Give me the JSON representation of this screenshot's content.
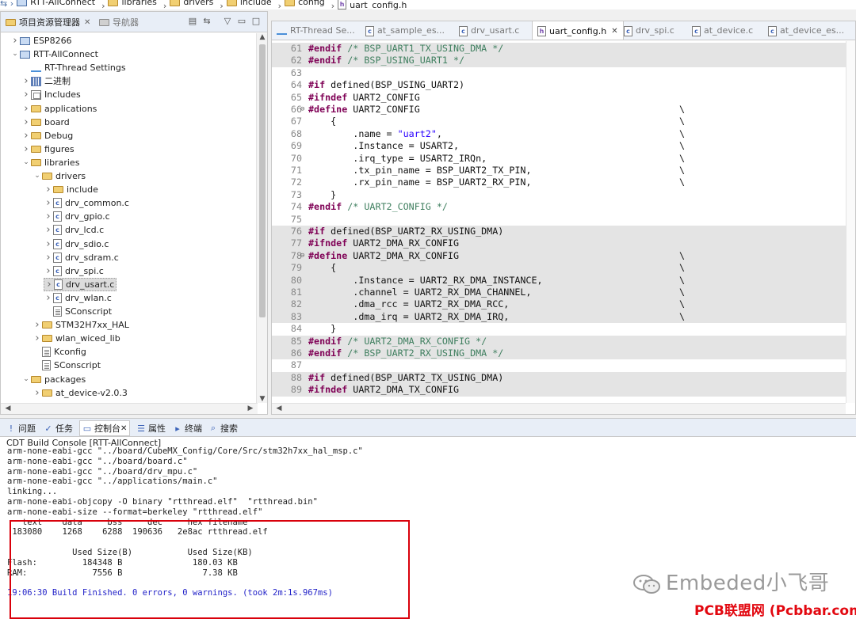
{
  "breadcrumb": [
    "RTT-AllConnect",
    "libraries",
    "drivers",
    "include",
    "config",
    "uart_config.h"
  ],
  "left_panel": {
    "tab_active": "项目资源管理器",
    "tab_other": "导航器",
    "tree": [
      {
        "label": "ESP8266",
        "icon": "project",
        "level": 0,
        "expanded": false
      },
      {
        "label": "RTT-AllConnect",
        "icon": "project",
        "level": 0,
        "expanded": true
      },
      {
        "label": "RT-Thread Settings",
        "icon": "settings",
        "level": 1,
        "expanded": null
      },
      {
        "label": "二进制",
        "icon": "binaries",
        "level": 1,
        "expanded": false
      },
      {
        "label": "Includes",
        "icon": "includes",
        "level": 1,
        "expanded": false
      },
      {
        "label": "applications",
        "icon": "folder",
        "level": 1,
        "expanded": false
      },
      {
        "label": "board",
        "icon": "folder",
        "level": 1,
        "expanded": false
      },
      {
        "label": "Debug",
        "icon": "folder",
        "level": 1,
        "expanded": false
      },
      {
        "label": "figures",
        "icon": "folder",
        "level": 1,
        "expanded": false
      },
      {
        "label": "libraries",
        "icon": "folder",
        "level": 1,
        "expanded": true
      },
      {
        "label": "drivers",
        "icon": "folder",
        "level": 2,
        "expanded": true
      },
      {
        "label": "include",
        "icon": "folder",
        "level": 3,
        "expanded": false
      },
      {
        "label": "drv_common.c",
        "icon": "c-file",
        "level": 3,
        "expanded": false
      },
      {
        "label": "drv_gpio.c",
        "icon": "c-file",
        "level": 3,
        "expanded": false
      },
      {
        "label": "drv_lcd.c",
        "icon": "c-file",
        "level": 3,
        "expanded": false
      },
      {
        "label": "drv_sdio.c",
        "icon": "c-file",
        "level": 3,
        "expanded": false
      },
      {
        "label": "drv_sdram.c",
        "icon": "c-file",
        "level": 3,
        "expanded": false
      },
      {
        "label": "drv_spi.c",
        "icon": "c-file",
        "level": 3,
        "expanded": false
      },
      {
        "label": "drv_usart.c",
        "icon": "c-file",
        "level": 3,
        "expanded": false,
        "selected": true
      },
      {
        "label": "drv_wlan.c",
        "icon": "c-file",
        "level": 3,
        "expanded": false
      },
      {
        "label": "SConscript",
        "icon": "script",
        "level": 3,
        "expanded": null
      },
      {
        "label": "STM32H7xx_HAL",
        "icon": "folder",
        "level": 2,
        "expanded": false
      },
      {
        "label": "wlan_wiced_lib",
        "icon": "folder",
        "level": 2,
        "expanded": false
      },
      {
        "label": "Kconfig",
        "icon": "script",
        "level": 2,
        "expanded": null
      },
      {
        "label": "SConscript",
        "icon": "script",
        "level": 2,
        "expanded": null
      },
      {
        "label": "packages",
        "icon": "folder",
        "level": 1,
        "expanded": true
      },
      {
        "label": "at_device-v2.0.3",
        "icon": "folder",
        "level": 2,
        "expanded": false
      }
    ]
  },
  "editor": {
    "tabs": [
      {
        "label": "RT-Thread Se...",
        "icon": "settings",
        "active": false
      },
      {
        "label": "at_sample_es...",
        "icon": "c-file",
        "active": false
      },
      {
        "label": "drv_usart.c",
        "icon": "c-file",
        "active": false
      },
      {
        "label": "uart_config.h",
        "icon": "h-file",
        "active": true
      },
      {
        "label": "drv_spi.c",
        "icon": "c-file",
        "active": false
      },
      {
        "label": "at_device.c",
        "icon": "c-file",
        "active": false
      },
      {
        "label": "at_device_es...",
        "icon": "c-file",
        "active": false
      }
    ],
    "lines": [
      {
        "n": "61",
        "hl": true,
        "fold": "",
        "bs": false,
        "parts": [
          [
            "kw",
            "#endif"
          ],
          [
            "",
            ""
          ],
          [
            "cm",
            " /* BSP_UART1_TX_USING_DMA */"
          ]
        ]
      },
      {
        "n": "62",
        "hl": true,
        "fold": "",
        "bs": false,
        "parts": [
          [
            "kw",
            "#endif"
          ],
          [
            "cm",
            " /* BSP_USING_UART1 */"
          ]
        ]
      },
      {
        "n": "63",
        "hl": false,
        "fold": "",
        "bs": false,
        "parts": []
      },
      {
        "n": "64",
        "hl": false,
        "fold": "",
        "bs": false,
        "parts": [
          [
            "kw",
            "#if"
          ],
          [
            "",
            " defined(BSP_USING_UART2)"
          ]
        ]
      },
      {
        "n": "65",
        "hl": false,
        "fold": "",
        "bs": false,
        "parts": [
          [
            "kw",
            "#ifndef"
          ],
          [
            "",
            " UART2_CONFIG"
          ]
        ]
      },
      {
        "n": "66",
        "hl": false,
        "fold": "⊖",
        "bs": true,
        "parts": [
          [
            "kw",
            "#define"
          ],
          [
            "",
            " UART2_CONFIG"
          ]
        ]
      },
      {
        "n": "67",
        "hl": false,
        "fold": "",
        "bs": true,
        "parts": [
          [
            "",
            "    {"
          ]
        ]
      },
      {
        "n": "68",
        "hl": false,
        "fold": "",
        "bs": true,
        "parts": [
          [
            "",
            "        .name = "
          ],
          [
            "st",
            "\"uart2\""
          ],
          [
            "",
            ","
          ]
        ]
      },
      {
        "n": "69",
        "hl": false,
        "fold": "",
        "bs": true,
        "parts": [
          [
            "",
            "        .Instance = USART2,"
          ]
        ]
      },
      {
        "n": "70",
        "hl": false,
        "fold": "",
        "bs": true,
        "parts": [
          [
            "",
            "        .irq_type = USART2_IRQn,"
          ]
        ]
      },
      {
        "n": "71",
        "hl": false,
        "fold": "",
        "bs": true,
        "parts": [
          [
            "",
            "        .tx_pin_name = BSP_UART2_TX_PIN,"
          ]
        ]
      },
      {
        "n": "72",
        "hl": false,
        "fold": "",
        "bs": true,
        "parts": [
          [
            "",
            "        .rx_pin_name = BSP_UART2_RX_PIN,"
          ]
        ]
      },
      {
        "n": "73",
        "hl": false,
        "fold": "",
        "bs": false,
        "parts": [
          [
            "",
            "    }"
          ]
        ]
      },
      {
        "n": "74",
        "hl": false,
        "fold": "",
        "bs": false,
        "parts": [
          [
            "kw",
            "#endif"
          ],
          [
            "cm",
            " /* UART2_CONFIG */"
          ]
        ]
      },
      {
        "n": "75",
        "hl": false,
        "fold": "",
        "bs": false,
        "parts": []
      },
      {
        "n": "76",
        "hl": true,
        "fold": "",
        "bs": false,
        "parts": [
          [
            "kw",
            "#if"
          ],
          [
            "",
            " defined(BSP_UART2_RX_USING_DMA)"
          ]
        ]
      },
      {
        "n": "77",
        "hl": true,
        "fold": "",
        "bs": false,
        "parts": [
          [
            "kw",
            "#ifndef"
          ],
          [
            "",
            " UART2_DMA_RX_CONFIG"
          ]
        ]
      },
      {
        "n": "78",
        "hl": true,
        "fold": "⊖",
        "bs": true,
        "parts": [
          [
            "kw",
            "#define"
          ],
          [
            "",
            " UART2_DMA_RX_CONFIG"
          ]
        ]
      },
      {
        "n": "79",
        "hl": true,
        "fold": "",
        "bs": true,
        "parts": [
          [
            "",
            "    {"
          ]
        ]
      },
      {
        "n": "80",
        "hl": true,
        "fold": "",
        "bs": true,
        "parts": [
          [
            "",
            "        .Instance = UART2_RX_DMA_INSTANCE,"
          ]
        ]
      },
      {
        "n": "81",
        "hl": true,
        "fold": "",
        "bs": true,
        "parts": [
          [
            "",
            "        .channel = UART2_RX_DMA_CHANNEL,"
          ]
        ]
      },
      {
        "n": "82",
        "hl": true,
        "fold": "",
        "bs": true,
        "parts": [
          [
            "",
            "        .dma_rcc = UART2_RX_DMA_RCC,"
          ]
        ]
      },
      {
        "n": "83",
        "hl": true,
        "fold": "",
        "bs": true,
        "parts": [
          [
            "",
            "        .dma_irq = UART2_RX_DMA_IRQ,"
          ]
        ]
      },
      {
        "n": "84",
        "hl": false,
        "fold": "",
        "bs": false,
        "parts": [
          [
            "",
            "    }"
          ]
        ]
      },
      {
        "n": "85",
        "hl": true,
        "fold": "",
        "bs": false,
        "parts": [
          [
            "kw",
            "#endif"
          ],
          [
            "cm",
            " /* UART2_DMA_RX_CONFIG */"
          ]
        ]
      },
      {
        "n": "86",
        "hl": true,
        "fold": "",
        "bs": false,
        "parts": [
          [
            "kw",
            "#endif"
          ],
          [
            "cm",
            " /* BSP_UART2_RX_USING_DMA */"
          ]
        ]
      },
      {
        "n": "87",
        "hl": false,
        "fold": "",
        "bs": false,
        "parts": []
      },
      {
        "n": "88",
        "hl": true,
        "fold": "",
        "bs": false,
        "parts": [
          [
            "kw",
            "#if"
          ],
          [
            "",
            " defined(BSP_UART2_TX_USING_DMA)"
          ]
        ]
      },
      {
        "n": "89",
        "hl": true,
        "fold": "",
        "bs": false,
        "parts": [
          [
            "kw",
            "#ifndef"
          ],
          [
            "",
            " UART2_DMA_TX_CONFIG"
          ]
        ]
      }
    ]
  },
  "bottom_tabs": [
    {
      "label": "问题",
      "icon": "problems-icon",
      "active": false
    },
    {
      "label": "任务",
      "icon": "tasks-icon",
      "active": false
    },
    {
      "label": "控制台",
      "icon": "console-icon",
      "active": true
    },
    {
      "label": "属性",
      "icon": "properties-icon",
      "active": false
    },
    {
      "label": "终端",
      "icon": "terminal-icon",
      "active": false
    },
    {
      "label": "搜索",
      "icon": "search-icon",
      "active": false
    }
  ],
  "console": {
    "title": "CDT Build Console [RTT-AllConnect]",
    "lines": [
      {
        "text": "arm-none-eabi-gcc \"../board/CubeMX_Config/Core/Src/stm32h7xx_hal_msp.c\"",
        "blue": false
      },
      {
        "text": "arm-none-eabi-gcc \"../board/board.c\"",
        "blue": false
      },
      {
        "text": "arm-none-eabi-gcc \"../board/drv_mpu.c\"",
        "blue": false
      },
      {
        "text": "arm-none-eabi-gcc \"../applications/main.c\"",
        "blue": false
      },
      {
        "text": "linking...",
        "blue": false
      },
      {
        "text": "arm-none-eabi-objcopy -O binary \"rtthread.elf\"  \"rtthread.bin\"",
        "blue": false
      },
      {
        "text": "arm-none-eabi-size --format=berkeley \"rtthread.elf\"",
        "blue": false
      },
      {
        "text": "   text    data     bss     dec     hex filename",
        "blue": false
      },
      {
        "text": " 183080    1268    6288  190636   2e8ac rtthread.elf",
        "blue": false
      },
      {
        "text": "",
        "blue": false
      },
      {
        "text": "             Used Size(B)           Used Size(KB)",
        "blue": false
      },
      {
        "text": "Flash:         184348 B              180.03 KB",
        "blue": false
      },
      {
        "text": "RAM:             7556 B                7.38 KB",
        "blue": false
      },
      {
        "text": "",
        "blue": false
      },
      {
        "text": "19:06:30 Build Finished. 0 errors, 0 warnings. (took 2m:1s.967ms)",
        "blue": true
      }
    ]
  },
  "watermark": "Embeded小飞哥",
  "credit": "PCB联盟网 (Pcbbar.com)",
  "colors": {
    "keyword": "#7f0055",
    "comment": "#3f7f5f",
    "string": "#2a00ff",
    "highlight": "#e4e4e4",
    "box": "#d9000b",
    "credit": "#e2070f"
  }
}
